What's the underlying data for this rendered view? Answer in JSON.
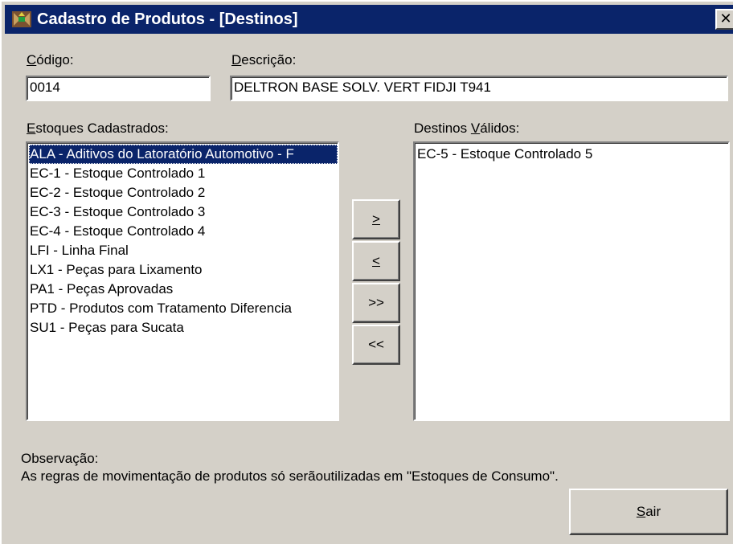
{
  "window": {
    "title": "Cadastro de Produtos - [Destinos]",
    "close_label": "✕",
    "title_color": "#0a246a",
    "face_color": "#d4d0c8"
  },
  "codigo": {
    "label_ul": "C",
    "label_rest": "ódigo:",
    "value": "0014"
  },
  "descricao": {
    "label_ul": "D",
    "label_rest": "escrição:",
    "value": "DELTRON BASE SOLV. VERT FIDJI T941"
  },
  "estoques": {
    "label_ul": "E",
    "label_rest": "stoques Cadastrados:",
    "items": [
      "ALA - Aditivos do Latoratório Automotivo - F",
      "EC-1 - Estoque Controlado 1",
      "EC-2 - Estoque Controlado 2",
      "EC-3 - Estoque Controlado 3",
      "EC-4 - Estoque Controlado 4",
      "LFI - Linha Final",
      "LX1 - Peças para Lixamento",
      "PA1 - Peças Aprovadas",
      "PTD - Produtos com Tratamento Diferencia",
      "SU1 - Peças para Sucata"
    ],
    "selected_index": 0
  },
  "destinos": {
    "label_pre": "Destinos ",
    "label_ul": "V",
    "label_rest": "álidos:",
    "items": [
      "EC-5 - Estoque Controlado 5"
    ]
  },
  "buttons": {
    "add_one": ">",
    "remove_one": "<",
    "add_all": ">>",
    "remove_all": "<<",
    "exit_ul": "S",
    "exit_rest": "air"
  },
  "observacao": {
    "title": "Observação:",
    "text": "As regras de movimentação de produtos só serãoutilizadas em \"Estoques de Consumo\"."
  }
}
